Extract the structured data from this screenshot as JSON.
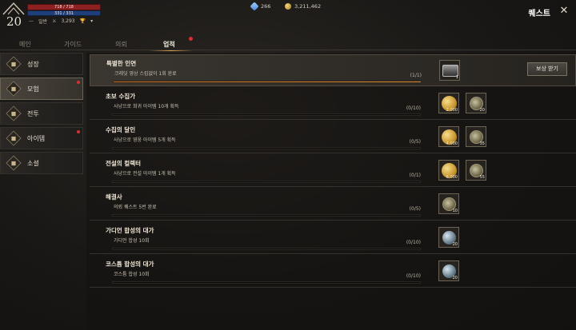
{
  "hud": {
    "level": "20",
    "hp_text": "718 / 718",
    "mp_text": "331 / 331",
    "rank_label": "일반",
    "power": "3,293",
    "gems": "266",
    "gold": "3,211,462",
    "title": "퀘스트"
  },
  "tabs": [
    {
      "label": "메인"
    },
    {
      "label": "가이드"
    },
    {
      "label": "의뢰"
    },
    {
      "label": "업적"
    }
  ],
  "sidebar": {
    "items": [
      {
        "label": "성장"
      },
      {
        "label": "모험"
      },
      {
        "label": "전투"
      },
      {
        "label": "아이템"
      },
      {
        "label": "소셜"
      }
    ]
  },
  "achievements": [
    {
      "title": "특별한 인연",
      "desc": "크레딧 영상 스킵없이 1회 완료",
      "count": "(1/1)",
      "progress": 1.0,
      "rewards": [
        {
          "type": "chest",
          "qty": "1"
        }
      ],
      "claim_label": "보상 받기"
    },
    {
      "title": "초보 수집가",
      "desc": "사냥으로 희귀 아이템 10개 획득",
      "count": "(0/10)",
      "progress": 0,
      "rewards": [
        {
          "type": "coin",
          "qty": "2,000"
        },
        {
          "type": "medal",
          "qty": "20"
        }
      ]
    },
    {
      "title": "수집의 달인",
      "desc": "사냥으로 영웅 아이템 5개 획득",
      "count": "(0/5)",
      "progress": 0,
      "rewards": [
        {
          "type": "coin",
          "qty": "4,000"
        },
        {
          "type": "medal",
          "qty": "35"
        }
      ]
    },
    {
      "title": "전설의 컬렉터",
      "desc": "사냥으로 전설 아이템 1개 획득",
      "count": "(0/1)",
      "progress": 0,
      "rewards": [
        {
          "type": "coin",
          "qty": "6,000"
        },
        {
          "type": "medal",
          "qty": "55"
        }
      ]
    },
    {
      "title": "해결사",
      "desc": "의뢰 퀘스트 5번 완료",
      "count": "(0/5)",
      "progress": 0,
      "rewards": [
        {
          "type": "medal",
          "qty": "10"
        }
      ]
    },
    {
      "title": "가디언 합성의 대가",
      "desc": "가디언 합성 10회",
      "count": "(0/10)",
      "progress": 0,
      "rewards": [
        {
          "type": "orb",
          "qty": "20"
        }
      ]
    },
    {
      "title": "코스튬 합성의 대가",
      "desc": "코스튬 합성 10회",
      "count": "(0/10)",
      "progress": 0,
      "rewards": [
        {
          "type": "orb",
          "qty": "20"
        }
      ]
    }
  ],
  "colors": {
    "accent": "#e08a2c",
    "alert": "#d63030"
  }
}
